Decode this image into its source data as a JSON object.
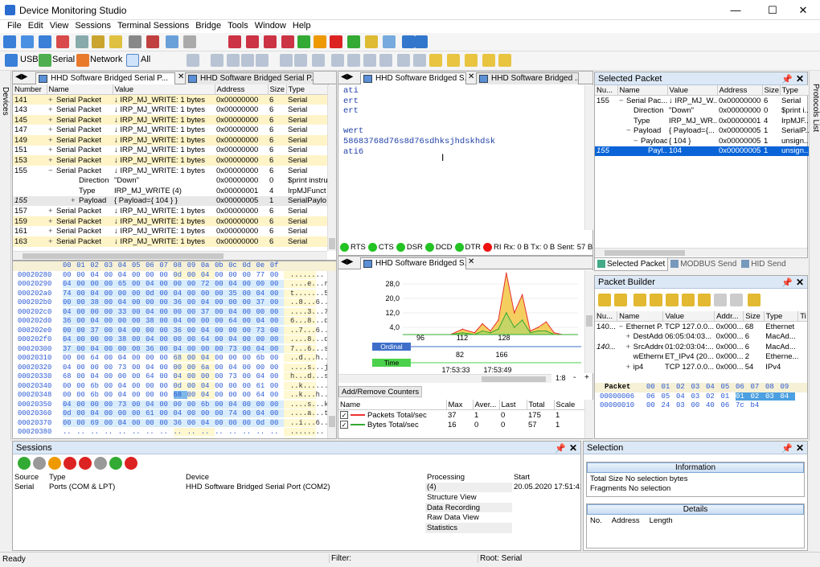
{
  "window": {
    "title": "Device Monitoring Studio",
    "minimize": "—",
    "maximize": "☐",
    "close": "✕"
  },
  "menu": [
    "File",
    "Edit",
    "View",
    "Sessions",
    "Terminal Sessions",
    "Bridge",
    "Tools",
    "Window",
    "Help"
  ],
  "filterbar": {
    "usb": "USB",
    "serial": "Serial",
    "network": "Network",
    "all": "All"
  },
  "sidebars": {
    "left": "Devices",
    "right": "Protocols List"
  },
  "packets": {
    "tabs": [
      "HHD Software Bridged Serial P...",
      "HHD Software Bridged Serial P..."
    ],
    "columns": [
      "Number",
      "Name",
      "Value",
      "Address",
      "Size",
      "Type"
    ],
    "rows": [
      {
        "n": "141",
        "name": "Serial Packet",
        "value": "↓ IRP_MJ_WRITE: 1 bytes",
        "addr": "0x00000000",
        "size": "6",
        "type": "Serial",
        "tog": "+"
      },
      {
        "n": "143",
        "name": "Serial Packet",
        "value": "↓ IRP_MJ_WRITE: 1 bytes",
        "addr": "0x00000000",
        "size": "6",
        "type": "Serial",
        "tog": "+"
      },
      {
        "n": "145",
        "name": "Serial Packet",
        "value": "↓ IRP_MJ_WRITE: 1 bytes",
        "addr": "0x00000000",
        "size": "6",
        "type": "Serial",
        "tog": "+"
      },
      {
        "n": "147",
        "name": "Serial Packet",
        "value": "↓ IRP_MJ_WRITE: 1 bytes",
        "addr": "0x00000000",
        "size": "6",
        "type": "Serial",
        "tog": "+"
      },
      {
        "n": "149",
        "name": "Serial Packet",
        "value": "↓ IRP_MJ_WRITE: 1 bytes",
        "addr": "0x00000000",
        "size": "6",
        "type": "Serial",
        "tog": "+"
      },
      {
        "n": "151",
        "name": "Serial Packet",
        "value": "↓ IRP_MJ_WRITE: 1 bytes",
        "addr": "0x00000000",
        "size": "6",
        "type": "Serial",
        "tog": "+"
      },
      {
        "n": "153",
        "name": "Serial Packet",
        "value": "↓ IRP_MJ_WRITE: 1 bytes",
        "addr": "0x00000000",
        "size": "6",
        "type": "Serial",
        "tog": "+"
      },
      {
        "n": "155",
        "name": "Serial Packet",
        "value": "↓ IRP_MJ_WRITE: 1 bytes",
        "addr": "0x00000000",
        "size": "6",
        "type": "Serial",
        "tog": "−"
      },
      {
        "n": "",
        "name": "Direction",
        "value": "\"Down\"",
        "addr": "0x00000000",
        "size": "0",
        "type": "$print instru",
        "ind": 1
      },
      {
        "n": "",
        "name": "Type",
        "value": "IRP_MJ_WRITE (4)",
        "addr": "0x00000001",
        "size": "4",
        "type": "IrpMJFunct",
        "ind": 1
      },
      {
        "n": "155",
        "name": "Payload",
        "value": "{ Payload={ 104 } }",
        "addr": "0x00000005",
        "size": "1",
        "type": "SerialPaylo",
        "ind": 1,
        "tog": "+",
        "italic": true
      },
      {
        "n": "157",
        "name": "Serial Packet",
        "value": "↓ IRP_MJ_WRITE: 1 bytes",
        "addr": "0x00000000",
        "size": "6",
        "type": "Serial",
        "tog": "+"
      },
      {
        "n": "159",
        "name": "Serial Packet",
        "value": "↓ IRP_MJ_WRITE: 1 bytes",
        "addr": "0x00000000",
        "size": "6",
        "type": "Serial",
        "tog": "+"
      },
      {
        "n": "161",
        "name": "Serial Packet",
        "value": "↓ IRP_MJ_WRITE: 1 bytes",
        "addr": "0x00000000",
        "size": "6",
        "type": "Serial",
        "tog": "+"
      },
      {
        "n": "163",
        "name": "Serial Packet",
        "value": "↓ IRP_MJ_WRITE: 1 bytes",
        "addr": "0x00000000",
        "size": "6",
        "type": "Serial",
        "tog": "+"
      }
    ]
  },
  "hex": {
    "header": [
      "00",
      "01",
      "02",
      "03",
      "04",
      "05",
      "06",
      "07",
      "08",
      "09",
      "0a",
      "0b",
      "0c",
      "0d",
      "0e",
      "0f"
    ],
    "rows": [
      {
        "addr": "00020280",
        "bytes": [
          "00",
          "00",
          "04",
          "00",
          "04",
          "00",
          "00",
          "00",
          "0d",
          "00",
          "04",
          "00",
          "00",
          "00",
          "77",
          "00"
        ],
        "ascii": "........"
      },
      {
        "addr": "00020290",
        "bytes": [
          "04",
          "00",
          "00",
          "00",
          "65",
          "00",
          "04",
          "00",
          "00",
          "00",
          "72",
          "00",
          "04",
          "00",
          "00",
          "00"
        ],
        "ascii": "....e...r..."
      },
      {
        "addr": "000202a0",
        "bytes": [
          "74",
          "00",
          "04",
          "00",
          "00",
          "00",
          "0d",
          "00",
          "04",
          "00",
          "00",
          "00",
          "35",
          "00",
          "04",
          "00"
        ],
        "ascii": "t.......5..."
      },
      {
        "addr": "000202b0",
        "bytes": [
          "00",
          "00",
          "38",
          "00",
          "04",
          "00",
          "00",
          "00",
          "36",
          "00",
          "04",
          "00",
          "00",
          "00",
          "37",
          "00"
        ],
        "ascii": "..8...6...7."
      },
      {
        "addr": "000202c0",
        "bytes": [
          "04",
          "00",
          "00",
          "00",
          "33",
          "00",
          "04",
          "00",
          "00",
          "00",
          "37",
          "00",
          "04",
          "00",
          "00",
          "00"
        ],
        "ascii": "....3...7..."
      },
      {
        "addr": "000202d0",
        "bytes": [
          "36",
          "00",
          "04",
          "00",
          "00",
          "00",
          "38",
          "00",
          "04",
          "00",
          "00",
          "00",
          "64",
          "00",
          "04",
          "00"
        ],
        "ascii": "6...8...d..."
      },
      {
        "addr": "000202e0",
        "bytes": [
          "00",
          "00",
          "37",
          "00",
          "04",
          "00",
          "00",
          "00",
          "36",
          "00",
          "04",
          "00",
          "00",
          "00",
          "73",
          "00"
        ],
        "ascii": "..7...6...s."
      },
      {
        "addr": "000202f0",
        "bytes": [
          "04",
          "00",
          "00",
          "00",
          "38",
          "00",
          "04",
          "00",
          "00",
          "00",
          "64",
          "00",
          "04",
          "00",
          "00",
          "00"
        ],
        "ascii": "....8...d..."
      },
      {
        "addr": "00020300",
        "bytes": [
          "37",
          "00",
          "04",
          "00",
          "00",
          "00",
          "36",
          "00",
          "04",
          "00",
          "00",
          "00",
          "73",
          "00",
          "04",
          "00"
        ],
        "ascii": "7...6...s..."
      },
      {
        "addr": "00020310",
        "bytes": [
          "00",
          "00",
          "64",
          "00",
          "04",
          "00",
          "00",
          "00",
          "68",
          "00",
          "04",
          "00",
          "00",
          "00",
          "6b",
          "00"
        ],
        "ascii": "..d...h...k."
      },
      {
        "addr": "00020320",
        "bytes": [
          "04",
          "00",
          "00",
          "00",
          "73",
          "00",
          "04",
          "00",
          "00",
          "00",
          "6a",
          "00",
          "04",
          "00",
          "00",
          "00"
        ],
        "ascii": "....s...j..."
      },
      {
        "addr": "00020330",
        "bytes": [
          "68",
          "00",
          "04",
          "00",
          "00",
          "00",
          "64",
          "00",
          "04",
          "00",
          "00",
          "00",
          "73",
          "00",
          "04",
          "00"
        ],
        "ascii": "h...d...s..."
      },
      {
        "addr": "00020340",
        "bytes": [
          "00",
          "00",
          "6b",
          "00",
          "04",
          "00",
          "00",
          "00",
          "0d",
          "00",
          "04",
          "00",
          "00",
          "00",
          "61",
          "00"
        ],
        "ascii": "..k.......a."
      },
      {
        "addr": "00020348",
        "bytes": [
          "00",
          "00",
          "6b",
          "00",
          "04",
          "00",
          "00",
          "00",
          "68",
          "00",
          "04",
          "00",
          "00",
          "00",
          "64",
          "00"
        ],
        "ascii": "..k...h...d."
      },
      {
        "addr": "00020350",
        "bytes": [
          "04",
          "00",
          "00",
          "00",
          "73",
          "00",
          "04",
          "00",
          "00",
          "00",
          "6b",
          "00",
          "04",
          "00",
          "00",
          "00"
        ],
        "ascii": "....s...k..."
      },
      {
        "addr": "00020360",
        "bytes": [
          "0d",
          "00",
          "04",
          "00",
          "00",
          "00",
          "61",
          "00",
          "04",
          "00",
          "00",
          "00",
          "74",
          "00",
          "04",
          "00"
        ],
        "ascii": "....a...t..."
      },
      {
        "addr": "00020370",
        "bytes": [
          "00",
          "00",
          "69",
          "00",
          "04",
          "00",
          "00",
          "00",
          "36",
          "00",
          "04",
          "00",
          "00",
          "00",
          "0d",
          "00"
        ],
        "ascii": "..i...6....."
      },
      {
        "addr": "00020380",
        "bytes": [
          "..",
          "..",
          "..",
          "..",
          "..",
          "..",
          "..",
          "..",
          "..",
          "..",
          "..",
          "..",
          "..",
          "..",
          "..",
          ".."
        ],
        "ascii": "........"
      },
      {
        "addr": "00020390",
        "bytes": [
          "..",
          "..",
          "..",
          "..",
          "..",
          "..",
          "..",
          "..",
          "..",
          "..",
          "..",
          "..",
          "..",
          "..",
          "..",
          ".."
        ],
        "ascii": "........"
      },
      {
        "addr": "000203a0",
        "bytes": [
          "..",
          "..",
          "..",
          "..",
          "..",
          "..",
          "..",
          "..",
          "..",
          "..",
          "..",
          "..",
          "..",
          "..",
          "..",
          ".."
        ],
        "ascii": "........"
      }
    ]
  },
  "terminal": {
    "tabs": [
      "HHD Software Bridged S...",
      "HHD Software Bridged ..."
    ],
    "lines": [
      "ati",
      "ert",
      "ert",
      "",
      "wert",
      "58683768d76s8d76sdhksjhdskhdsk",
      "ati6"
    ],
    "signals": [
      {
        "name": "RTS",
        "color": "#22c322"
      },
      {
        "name": "CTS",
        "color": "#22c322"
      },
      {
        "name": "DSR",
        "color": "#22c322"
      },
      {
        "name": "DCD",
        "color": "#22c322"
      },
      {
        "name": "DTR",
        "color": "#22c322"
      },
      {
        "name": "RI",
        "color": "#e11"
      }
    ],
    "stats": "Rx: 0 B Tx: 0 B Sent: 57 B Recei"
  },
  "statistics": {
    "tab": "HHD Software Bridged S...",
    "add_remove": "Add/Remove Counters",
    "ordinal_label": "Ordinal",
    "time_label": "Time",
    "ordinal_ticks": [
      "96",
      "112",
      "128"
    ],
    "ordinal_ticks2": [
      "82",
      "166"
    ],
    "time_ticks": [
      "17:53:33",
      "17:53:49"
    ],
    "zoom": "1:8",
    "columns": [
      "Name",
      "Max",
      "Aver...",
      "Last",
      "Total",
      "Scale"
    ],
    "counters": [
      {
        "name": "Packets Total/sec",
        "max": "37",
        "avg": "1",
        "last": "0",
        "total": "175",
        "scale": "1",
        "color": "#e33"
      },
      {
        "name": "Bytes Total/sec",
        "max": "16",
        "avg": "0",
        "last": "0",
        "total": "57",
        "scale": "1",
        "color": "#3a3"
      }
    ]
  },
  "chart_data": {
    "type": "area",
    "ylim": [
      0,
      32
    ],
    "y_ticks": [
      "28,0",
      "20,0",
      "12,0",
      "4,0"
    ],
    "y_tick_values": [
      28,
      20,
      12,
      4
    ],
    "x": [
      90,
      93,
      96,
      99,
      102,
      105,
      108,
      110,
      112,
      114,
      116,
      118,
      120,
      122,
      124,
      126,
      128,
      130,
      132,
      134
    ],
    "series": [
      {
        "values": [
          0,
          0,
          0,
          0,
          0,
          3,
          1,
          6,
          2,
          8,
          34,
          12,
          22,
          2,
          4,
          7,
          1,
          0,
          0,
          0
        ],
        "color": "#e53030"
      },
      {
        "values": [
          0,
          0,
          0,
          0,
          0,
          1,
          0,
          2,
          1,
          3,
          12,
          4,
          8,
          1,
          2,
          2,
          0,
          0,
          0,
          0
        ],
        "color": "#33aa33"
      }
    ]
  },
  "selected_packet": {
    "title": "Selected Packet",
    "columns": [
      "Nu...",
      "Name",
      "Value",
      "Address",
      "Size",
      "Type"
    ],
    "rows": [
      {
        "n": "155",
        "name": "Serial Pac...",
        "value": "↓ IRP_MJ_W...",
        "addr": "0x00000000",
        "size": "6",
        "type": "Serial",
        "ind": 0,
        "tog": "−"
      },
      {
        "n": "",
        "name": "Direction",
        "value": "\"Down\"",
        "addr": "0x00000000",
        "size": "0",
        "type": "$print i...",
        "ind": 1
      },
      {
        "n": "",
        "name": "Type",
        "value": "IRP_MJ_WR...",
        "addr": "0x00000001",
        "size": "4",
        "type": "IrpMJF...",
        "ind": 1
      },
      {
        "n": "",
        "name": "Payload",
        "value": "{ Payload={...",
        "addr": "0x00000005",
        "size": "1",
        "type": "SerialP...",
        "ind": 1,
        "tog": "−"
      },
      {
        "n": "",
        "name": "Payload",
        "value": "{ 104 }",
        "addr": "0x00000005",
        "size": "1",
        "type": "unsign...",
        "ind": 2,
        "tog": "−"
      },
      {
        "n": "155",
        "name": "Payl...",
        "value": "104",
        "addr": "0x00000005",
        "size": "1",
        "type": "unsign...",
        "ind": 3,
        "sel": true
      }
    ],
    "bottom_tabs": [
      "Selected Packet",
      "MODBUS Send",
      "HID Send"
    ]
  },
  "packet_builder": {
    "title": "Packet Builder",
    "columns": [
      "Nu...",
      "Name",
      "Value",
      "Addr...",
      "Size",
      "Type",
      "Ti"
    ],
    "rows": [
      {
        "n": "140...",
        "name": "Ethernet P...",
        "value": "TCP 127.0.0...",
        "addr": "0x000...",
        "size": "68",
        "type": "Ethernet",
        "ind": 0,
        "tog": "−"
      },
      {
        "n": "",
        "name": "DestAddr...",
        "value": "06:05:04:03...",
        "addr": "0x000...",
        "size": "6",
        "type": "MacAd...",
        "ind": 1,
        "tog": "+"
      },
      {
        "n": "140...",
        "name": "SrcAddress",
        "value": "01:02:03:04:...",
        "addr": "0x000...",
        "size": "6",
        "type": "MacAd...",
        "ind": 1,
        "tog": "+",
        "italic": true
      },
      {
        "n": "",
        "name": "wEtherne...",
        "value": "ET_IPv4 (20...",
        "addr": "0x000...",
        "size": "2",
        "type": "Etherne...",
        "ind": 1
      },
      {
        "n": "",
        "name": "ip4",
        "value": "TCP 127.0.0...",
        "addr": "0x000...",
        "size": "54",
        "type": "IPv4",
        "ind": 1,
        "tog": "+"
      }
    ],
    "hex_header_label": "Packet",
    "hex_header": [
      "00",
      "01",
      "02",
      "03",
      "04",
      "05",
      "06",
      "07",
      "08",
      "09"
    ],
    "hex_rows": [
      {
        "addr": "00000006",
        "bytes": [
          "06",
          "05",
          "04",
          "03",
          "02",
          "01",
          "01",
          "02",
          "03",
          "04"
        ]
      },
      {
        "addr": "00000010",
        "bytes": [
          "00",
          "24",
          "03",
          "00",
          "40",
          "06",
          "7c",
          "b4",
          "",
          ""
        ]
      }
    ]
  },
  "sessions": {
    "title": "Sessions",
    "columns": [
      "Source",
      "Type",
      "Device",
      "Processing",
      "Start"
    ],
    "row": {
      "source": "Serial",
      "type": "Ports (COM & LPT)",
      "device": "HHD Software Bridged Serial Port (COM2)",
      "start": "20.05.2020 17:51:41"
    },
    "processing": [
      "(4)",
      "Structure View",
      "Data Recording",
      "Raw Data View",
      "Statistics"
    ]
  },
  "selection": {
    "title": "Selection",
    "info_header": "Information",
    "total_size_label": "Total Size",
    "total_size_value": "No selection  bytes",
    "fragments_label": "Fragments",
    "fragments_value": "No selection",
    "details_header": "Details",
    "detail_columns": [
      "No.",
      "Address",
      "Length"
    ]
  },
  "status": {
    "ready": "Ready",
    "filter": "Filter:",
    "root": "Root: Serial"
  }
}
